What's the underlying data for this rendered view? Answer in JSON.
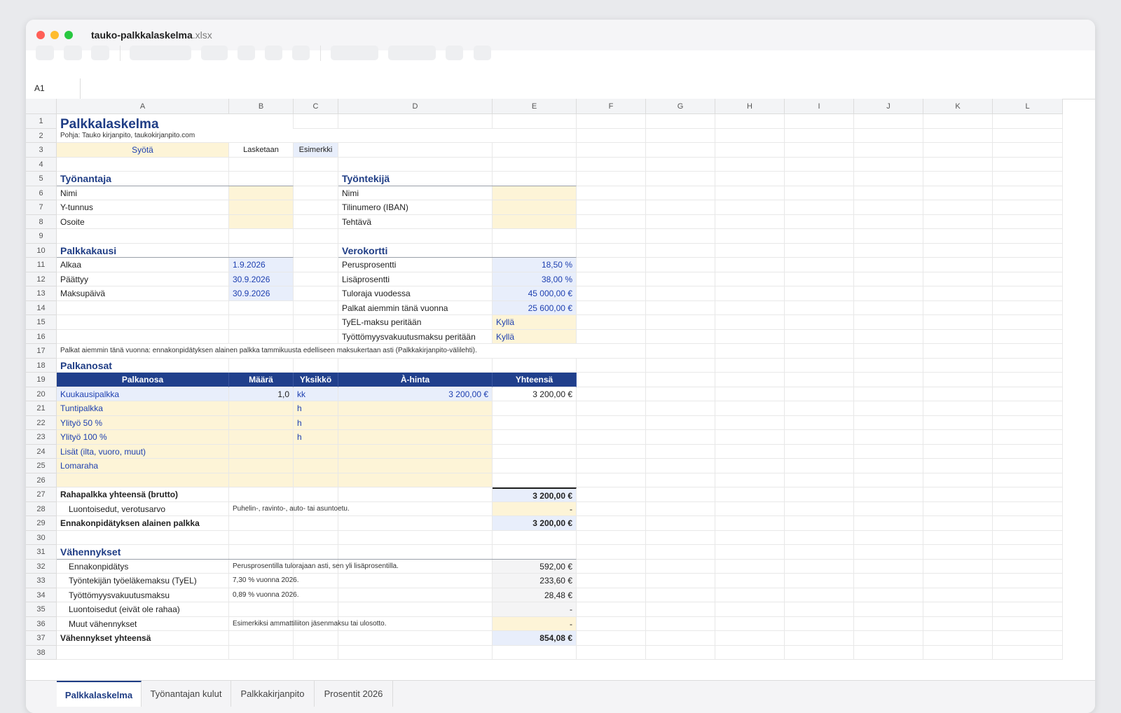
{
  "window": {
    "title_base": "tauko-palkkalaskelma",
    "title_ext": ".xlsx"
  },
  "formula_bar": {
    "name_box": "A1"
  },
  "columns": [
    "A",
    "B",
    "C",
    "D",
    "E",
    "F",
    "G",
    "H",
    "I",
    "J",
    "K",
    "L"
  ],
  "rows": [
    "1",
    "2",
    "3",
    "4",
    "5",
    "6",
    "7",
    "8",
    "9",
    "10",
    "11",
    "12",
    "13",
    "14",
    "15",
    "16",
    "17",
    "18",
    "19",
    "20",
    "21",
    "22",
    "23",
    "24",
    "25",
    "26",
    "27",
    "28",
    "29",
    "30",
    "31",
    "32",
    "33",
    "34",
    "35",
    "36",
    "37",
    "38"
  ],
  "sheet": {
    "title": "Palkkalaskelma",
    "source": "Pohja: Tauko kirjanpito, taukokirjanpito.com",
    "legend": {
      "input": "Syötä",
      "calc": "Lasketaan",
      "example": "Esimerkki"
    },
    "employer": {
      "heading": "Työnantaja",
      "name": "Nimi",
      "ytunnus": "Y-tunnus",
      "address": "Osoite"
    },
    "employee": {
      "heading": "Työntekijä",
      "name": "Nimi",
      "iban": "Tilinumero (IBAN)",
      "role": "Tehtävä"
    },
    "period": {
      "heading": "Palkkakausi",
      "start_label": "Alkaa",
      "start_value": "1.9.2026",
      "end_label": "Päättyy",
      "end_value": "30.9.2026",
      "pay_label": "Maksupäivä",
      "pay_value": "30.9.2026"
    },
    "taxcard": {
      "heading": "Verokortti",
      "base_label": "Perusprosentti",
      "base_value": "18,50 %",
      "extra_label": "Lisäprosentti",
      "extra_value": "38,00 %",
      "limit_label": "Tuloraja vuodessa",
      "limit_value": "45 000,00 €",
      "earlier_label": "Palkat aiemmin tänä vuonna",
      "earlier_value": "25 600,00 €",
      "tyel_label": "TyEL-maksu peritään",
      "tyel_value": "Kyllä",
      "unemp_label": "Työttömyysvakuutusmaksu peritään",
      "unemp_value": "Kyllä"
    },
    "note17": "Palkat aiemmin tänä vuonna: ennakonpidätyksen alainen palkka tammikuusta edelliseen maksukertaan asti (Palkkakirjanpito-välilehti).",
    "wages": {
      "heading": "Palkanosat",
      "headers": [
        "Palkanosa",
        "Määrä",
        "Yksikkö",
        "À-hinta",
        "Yhteensä"
      ],
      "rows": [
        {
          "name": "Kuukausipalkka",
          "qty": "1,0",
          "unit": "kk",
          "price": "3 200,00 €",
          "total": "3 200,00 €"
        },
        {
          "name": "Tuntipalkka",
          "qty": "",
          "unit": "h",
          "price": "",
          "total": ""
        },
        {
          "name": "Ylityö 50 %",
          "qty": "",
          "unit": "h",
          "price": "",
          "total": ""
        },
        {
          "name": "Ylityö 100 %",
          "qty": "",
          "unit": "h",
          "price": "",
          "total": ""
        },
        {
          "name": "Lisät (ilta, vuoro, muut)",
          "qty": "",
          "unit": "",
          "price": "",
          "total": ""
        },
        {
          "name": "Lomaraha",
          "qty": "",
          "unit": "",
          "price": "",
          "total": ""
        },
        {
          "name": "",
          "qty": "",
          "unit": "",
          "price": "",
          "total": ""
        }
      ]
    },
    "gross_label": "Rahapalkka yhteensä (brutto)",
    "gross_value": "3 200,00 €",
    "benefits_label": "Luontoisedut, verotusarvo",
    "benefits_note": "Puhelin-, ravinto-, auto- tai asuntoetu.",
    "benefits_value": "-",
    "taxable_label": "Ennakonpidätyksen alainen palkka",
    "taxable_value": "3 200,00 €",
    "deductions": {
      "heading": "Vähennykset",
      "rows": [
        {
          "label": "Ennakonpidätys",
          "note": "Perusprosentilla tulorajaan asti, sen yli lisäprosentilla.",
          "value": "592,00 €"
        },
        {
          "label": "Työntekijän työeläkemaksu (TyEL)",
          "note": "7,30 % vuonna 2026.",
          "value": "233,60 €"
        },
        {
          "label": "Työttömyysvakuutusmaksu",
          "note": "0,89 % vuonna 2026.",
          "value": "28,48 €"
        },
        {
          "label": "Luontoisedut (eivät ole rahaa)",
          "note": "",
          "value": "-"
        },
        {
          "label": "Muut vähennykset",
          "note": "Esimerkiksi ammattiliiton jäsenmaksu tai ulosotto.",
          "value": "-"
        }
      ],
      "total_label": "Vähennykset yhteensä",
      "total_value": "854,08 €"
    }
  },
  "tabs": [
    "Palkkalaskelma",
    "Työnantajan kulut",
    "Palkkakirjanpito",
    "Prosentit 2026"
  ],
  "active_tab": "Palkkalaskelma"
}
